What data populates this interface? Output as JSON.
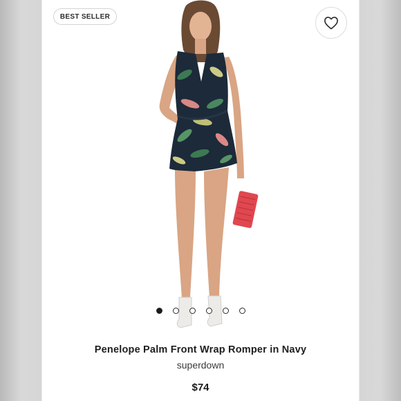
{
  "badge": {
    "label": "BEST SELLER"
  },
  "product": {
    "title": "Penelope Palm Front Wrap Romper in Navy",
    "brand": "superdown",
    "price": "$74"
  },
  "carousel": {
    "count": 6,
    "active_index": 0
  },
  "icons": {
    "wishlist": "heart-icon"
  },
  "colors": {
    "romper": "#1c2a3a",
    "clutch": "#e0474f",
    "leaf_green": "#3f7f55",
    "flower_pink": "#e48e8a"
  }
}
